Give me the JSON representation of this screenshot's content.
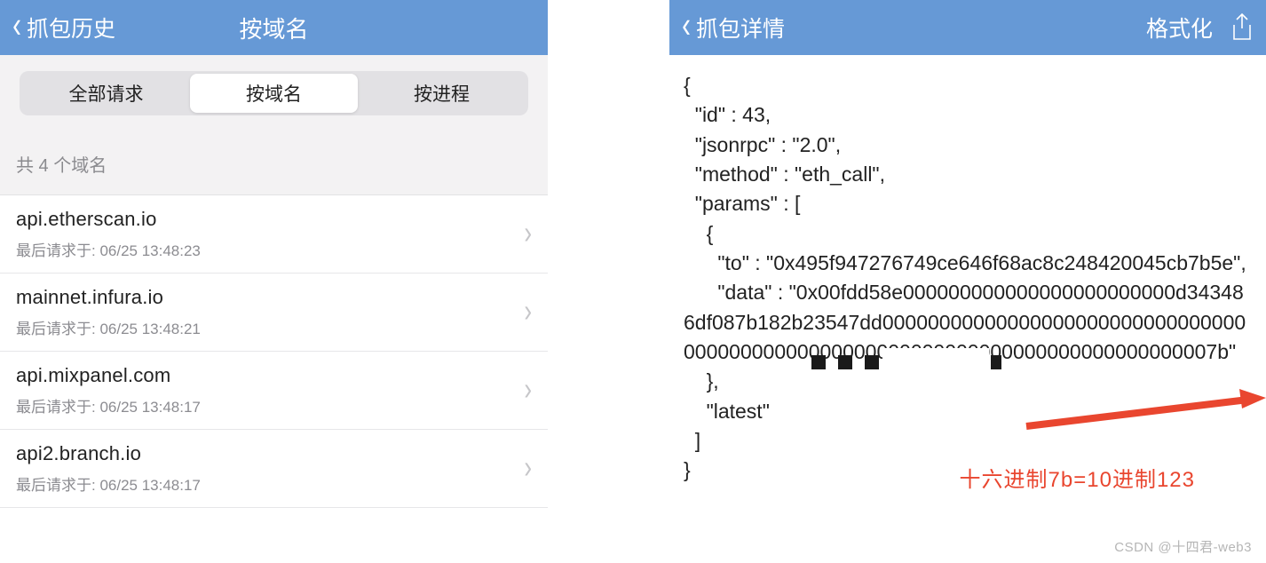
{
  "left": {
    "back": "抓包历史",
    "title": "按域名",
    "tabs": [
      "全部请求",
      "按域名",
      "按进程"
    ],
    "active_tab": 1,
    "section_label": "共 4 个域名",
    "rows": [
      {
        "title": "api.etherscan.io",
        "sub": "最后请求于: 06/25 13:48:23"
      },
      {
        "title": "mainnet.infura.io",
        "sub": "最后请求于: 06/25 13:48:21"
      },
      {
        "title": "api.mixpanel.com",
        "sub": "最后请求于: 06/25 13:48:17"
      },
      {
        "title": "api2.branch.io",
        "sub": "最后请求于: 06/25 13:48:17"
      }
    ]
  },
  "right": {
    "back": "抓包详情",
    "format": "格式化",
    "json_text": "{\n  \"id\" : 43,\n  \"jsonrpc\" : \"2.0\",\n  \"method\" : \"eth_call\",\n  \"params\" : [\n    {\n      \"to\" : \"0x495f947276749ce646f68ac8c248420045cb7b5e\",\n      \"data\" : \"0x00fdd58e000000000000000000000000d343486df087b182b23547dd0000000000000000000000000000000000000000000000000000000000000000000000000000007b\"\n    },\n    \"latest\"\n  ]\n}",
    "annotation": "十六进制7b=10进制123"
  },
  "watermark": "CSDN @十四君-web3"
}
